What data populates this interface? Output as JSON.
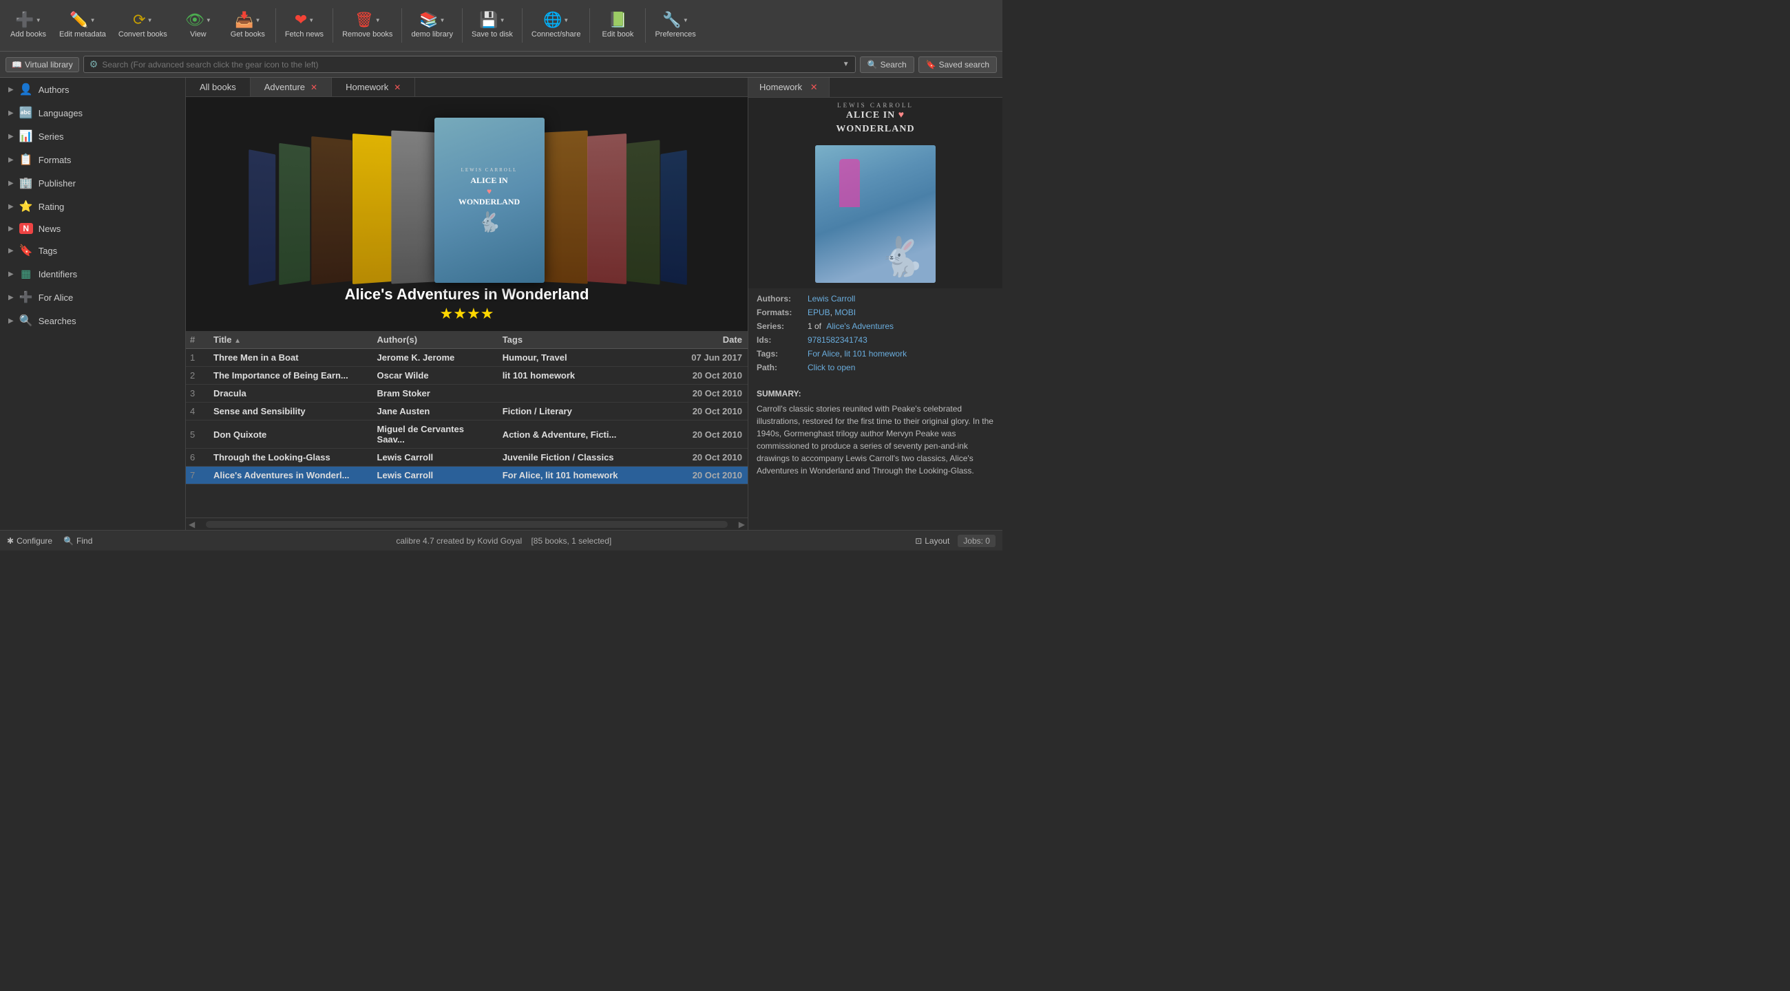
{
  "toolbar": {
    "buttons": [
      {
        "id": "add-books",
        "label": "Add books",
        "icon": "➕",
        "color": "icon-green",
        "has_arrow": true
      },
      {
        "id": "edit-metadata",
        "label": "Edit metadata",
        "icon": "✏️",
        "color": "icon-blue",
        "has_arrow": true
      },
      {
        "id": "convert-books",
        "label": "Convert books",
        "icon": "🔄",
        "color": "icon-yellow",
        "has_arrow": true
      },
      {
        "id": "view",
        "label": "View",
        "icon": "👁️",
        "color": "icon-green",
        "has_arrow": true
      },
      {
        "id": "get-books",
        "label": "Get books",
        "icon": "📥",
        "color": "icon-blue",
        "has_arrow": true
      },
      {
        "id": "fetch-news",
        "label": "Fetch news",
        "icon": "❤️",
        "color": "icon-red",
        "has_arrow": true
      },
      {
        "id": "remove-books",
        "label": "Remove books",
        "icon": "🗑️",
        "color": "icon-red",
        "has_arrow": true
      },
      {
        "id": "demo-library",
        "label": "demo library",
        "icon": "📚",
        "color": "icon-orange",
        "has_arrow": true
      },
      {
        "id": "save-to-disk",
        "label": "Save to disk",
        "icon": "💾",
        "color": "icon-blue",
        "has_arrow": true
      },
      {
        "id": "connect-share",
        "label": "Connect/share",
        "icon": "🌐",
        "color": "icon-gray",
        "has_arrow": true
      },
      {
        "id": "edit-book",
        "label": "Edit book",
        "icon": "📗",
        "color": "icon-purple",
        "has_arrow": false
      },
      {
        "id": "preferences",
        "label": "Preferences",
        "icon": "🔧",
        "color": "icon-gray",
        "has_arrow": true
      }
    ]
  },
  "searchbar": {
    "vlib_label": "Virtual library",
    "search_placeholder": "Search (For advanced search click the gear icon to the left)",
    "search_btn": "Search",
    "saved_btn": "Saved search"
  },
  "tabs": [
    {
      "id": "all-books",
      "label": "All books",
      "closeable": false
    },
    {
      "id": "adventure",
      "label": "Adventure",
      "closeable": true,
      "active": true
    },
    {
      "id": "homework",
      "label": "Homework",
      "closeable": true
    }
  ],
  "sidebar": {
    "items": [
      {
        "id": "authors",
        "label": "Authors",
        "icon": "👤",
        "color": "#8ab"
      },
      {
        "id": "languages",
        "label": "Languages",
        "icon": "🔤",
        "color": "#6af"
      },
      {
        "id": "series",
        "label": "Series",
        "icon": "📊",
        "color": "#46f"
      },
      {
        "id": "formats",
        "label": "Formats",
        "icon": "📋",
        "color": "#da8"
      },
      {
        "id": "publisher",
        "label": "Publisher",
        "icon": "🏢",
        "color": "#c95"
      },
      {
        "id": "rating",
        "label": "Rating",
        "icon": "⭐",
        "color": "#fd0"
      },
      {
        "id": "news",
        "label": "News",
        "icon": "🅽",
        "color": "#e44"
      },
      {
        "id": "tags",
        "label": "Tags",
        "icon": "🔖",
        "color": "#8a4"
      },
      {
        "id": "identifiers",
        "label": "Identifiers",
        "icon": "▦",
        "color": "#4a8"
      },
      {
        "id": "for-alice",
        "label": "For Alice",
        "icon": "➕",
        "color": "#66f"
      },
      {
        "id": "searches",
        "label": "Searches",
        "icon": "🔍",
        "color": "#aaa"
      }
    ]
  },
  "book_display": {
    "title": "Alice's Adventures in Wonderland",
    "stars": "★★★★"
  },
  "books": [
    {
      "num": 1,
      "title": "Three Men in a Boat",
      "author": "Jerome K. Jerome",
      "tags": "Humour, Travel",
      "date": "07 Jun 2017",
      "selected": false
    },
    {
      "num": 2,
      "title": "The Importance of Being Earn...",
      "author": "Oscar Wilde",
      "tags": "lit 101 homework",
      "date": "20 Oct 2010",
      "selected": false
    },
    {
      "num": 3,
      "title": "Dracula",
      "author": "Bram Stoker",
      "tags": "",
      "date": "20 Oct 2010",
      "selected": false
    },
    {
      "num": 4,
      "title": "Sense and Sensibility",
      "author": "Jane Austen",
      "tags": "Fiction / Literary",
      "date": "20 Oct 2010",
      "selected": false
    },
    {
      "num": 5,
      "title": "Don Quixote",
      "author": "Miguel de Cervantes Saav...",
      "tags": "Action & Adventure, Ficti...",
      "date": "20 Oct 2010",
      "selected": false
    },
    {
      "num": 6,
      "title": "Through the Looking-Glass",
      "author": "Lewis Carroll",
      "tags": "Juvenile Fiction / Classics",
      "date": "20 Oct 2010",
      "selected": false
    },
    {
      "num": 7,
      "title": "Alice's Adventures in Wonderl...",
      "author": "Lewis Carroll",
      "tags": "For Alice, lit 101 homework",
      "date": "20 Oct 2010",
      "selected": true
    }
  ],
  "detail": {
    "tab_label": "Homework",
    "book_publisher_title": "LEWIS CARROLL",
    "book_sub_title": "ALICE IN ♥ WONDERLAND",
    "authors_label": "Authors:",
    "authors_value": "Lewis Carroll",
    "formats_label": "Formats:",
    "formats_epub": "EPUB",
    "formats_mobi": "MOBI",
    "series_label": "Series:",
    "series_value": "1 of",
    "series_name": "Alice's Adventures",
    "ids_label": "Ids:",
    "ids_value": "9781582341743",
    "tags_label": "Tags:",
    "tags_for_alice": "For Alice",
    "tags_homework": "lit 101 homework",
    "path_label": "Path:",
    "path_value": "Click to open",
    "summary_label": "SUMMARY:",
    "summary_text": "Carroll's classic stories reunited with Peake's celebrated illustrations, restored for the first time to their original glory. In the 1940s, Gormenghast trilogy author Mervyn Peake was commissioned to produce a series of seventy pen-and-ink drawings to accompany Lewis Carroll's two classics, Alice's Adventures in Wonderland and Through the Looking-Glass."
  },
  "statusbar": {
    "app_label": "calibre 4.7 created by Kovid Goyal",
    "book_count": "[85 books, 1 selected]",
    "configure_label": "Configure",
    "find_label": "Find",
    "layout_label": "Layout",
    "jobs_label": "Jobs: 0"
  }
}
